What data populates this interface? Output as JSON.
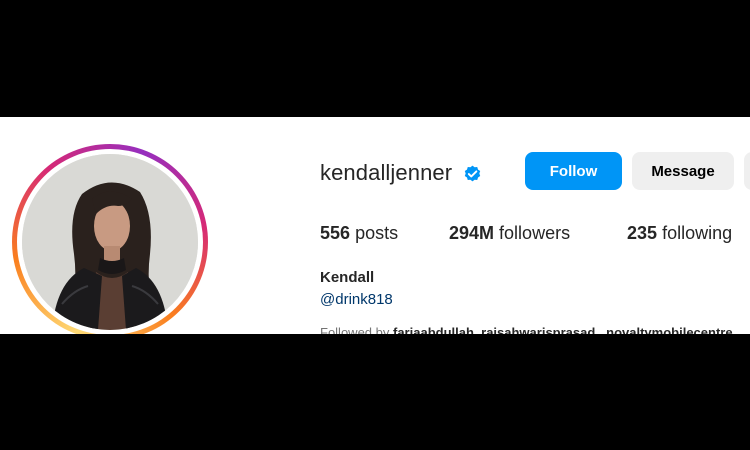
{
  "profile": {
    "username": "kendalljenner",
    "verified_icon": "verified-badge-icon",
    "full_name": "Kendall",
    "bio_link": "@drink818",
    "avatar_icon": "profile-photo"
  },
  "buttons": {
    "follow_label": "Follow",
    "message_label": "Message"
  },
  "stats": {
    "posts_count": "556",
    "posts_label": "posts",
    "followers_count": "294M",
    "followers_label": "followers",
    "following_count": "235",
    "following_label": "following"
  },
  "followed_by": {
    "prefix": "Followed by",
    "names": "fariaabdullah, raisahwarisprasad , novaltymobilecentre"
  },
  "colors": {
    "follow_button": "#0095f6",
    "secondary_button": "#efefef",
    "verified_badge": "#0095f6",
    "link": "#00376b",
    "text_primary": "#262626",
    "text_secondary": "#737373"
  }
}
